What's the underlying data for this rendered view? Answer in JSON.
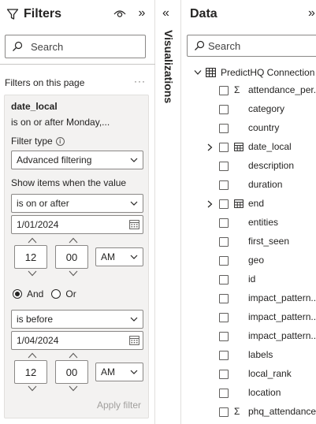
{
  "filters": {
    "title": "Filters",
    "search_placeholder": "Search",
    "section_label": "Filters on this page",
    "more": "···",
    "card": {
      "field": "date_local",
      "summary": "is on or after Monday,...",
      "filter_type_label": "Filter type",
      "filter_type_value": "Advanced filtering",
      "show_items_label": "Show items when the value",
      "condition1": {
        "operator": "is on or after",
        "date": "1/01/2024",
        "hour": "12",
        "minute": "00",
        "ampm": "AM"
      },
      "logic": {
        "and_label": "And",
        "or_label": "Or",
        "selected": "And"
      },
      "condition2": {
        "operator": "is before",
        "date": "1/04/2024",
        "hour": "12",
        "minute": "00",
        "ampm": "AM"
      },
      "apply_label": "Apply filter"
    }
  },
  "visualizations": {
    "label": "Visualizations"
  },
  "data": {
    "title": "Data",
    "search_placeholder": "Search",
    "connection": "PredictHQ Connection",
    "fields": [
      {
        "label": "attendance_per...",
        "kind": "sigma"
      },
      {
        "label": "category",
        "kind": "plain"
      },
      {
        "label": "country",
        "kind": "plain"
      },
      {
        "label": "date_local",
        "kind": "table"
      },
      {
        "label": "description",
        "kind": "plain"
      },
      {
        "label": "duration",
        "kind": "plain"
      },
      {
        "label": "end",
        "kind": "table"
      },
      {
        "label": "entities",
        "kind": "plain"
      },
      {
        "label": "first_seen",
        "kind": "plain"
      },
      {
        "label": "geo",
        "kind": "plain"
      },
      {
        "label": "id",
        "kind": "plain"
      },
      {
        "label": "impact_pattern...",
        "kind": "plain"
      },
      {
        "label": "impact_pattern...",
        "kind": "plain"
      },
      {
        "label": "impact_pattern...",
        "kind": "plain"
      },
      {
        "label": "labels",
        "kind": "plain"
      },
      {
        "label": "local_rank",
        "kind": "plain"
      },
      {
        "label": "location",
        "kind": "plain"
      },
      {
        "label": "phq_attendance",
        "kind": "sigma"
      }
    ]
  },
  "colors": {
    "border": "#8a8886",
    "card_bg": "#f3f2f1",
    "text": "#252423",
    "disabled": "#a19f9d"
  }
}
